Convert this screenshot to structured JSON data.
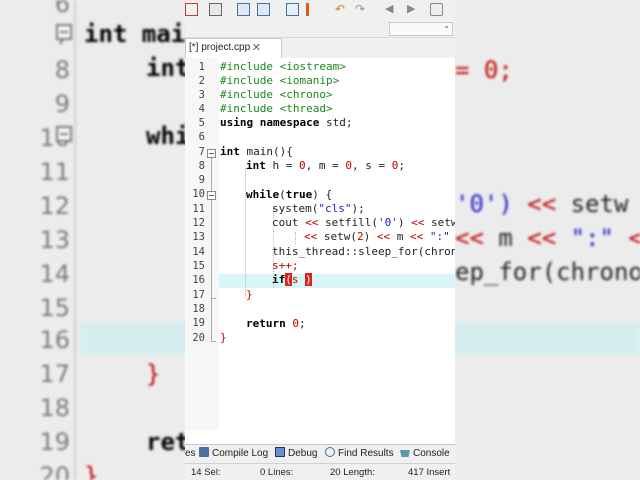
{
  "background_code": {
    "line_numbers": [
      "6",
      "7",
      "8",
      "9",
      "10",
      "11",
      "12",
      "13",
      "14",
      "15",
      "16",
      "17",
      "18",
      "19",
      "20"
    ],
    "line7": "int main",
    "line8": "int",
    "line8_tail": "= 0;",
    "line10": "whi",
    "line12_a": "'0')",
    "line12_b": "<<",
    "line12_c": "setw",
    "line13_a": "<<",
    "line13_b": "m",
    "line13_c": "<<",
    "line13_d": "\":\"",
    "line13_e": "<",
    "line14": "ep_for(chrono",
    "line17": "}",
    "line19": "ret",
    "line20": "}"
  },
  "toolbar": {
    "icons": [
      "bookmark-icon",
      "print-icon",
      "find-icon",
      "replace-icon",
      "goto-icon",
      "indent-icon",
      "undo-icon",
      "redo-icon",
      "back-icon",
      "forward-icon",
      "debug-icon"
    ]
  },
  "tab": {
    "label": "[*] project.cpp",
    "close": "✕"
  },
  "editor": {
    "line_numbers": [
      "1",
      "2",
      "3",
      "4",
      "5",
      "6",
      "7",
      "8",
      "9",
      "10",
      "11",
      "12",
      "13",
      "14",
      "15",
      "16",
      "17",
      "18",
      "19",
      "20"
    ],
    "lines": {
      "l1_a": "#include ",
      "l1_b": "<iostream>",
      "l2_a": "#include ",
      "l2_b": "<iomanip>",
      "l3_a": "#include ",
      "l3_b": "<chrono>",
      "l4_a": "#include ",
      "l4_b": "<thread>",
      "l5_a": "using namespace",
      "l5_b": " std;",
      "l7_a": "int",
      "l7_b": " main(){",
      "l8_a": "int",
      "l8_b": " h = ",
      "l8_c": "0",
      "l8_d": ", m = ",
      "l8_e": "0",
      "l8_f": ", s = ",
      "l8_g": "0",
      "l8_h": ";",
      "l10_a": "while",
      "l10_b": "(",
      "l10_c": "true",
      "l10_d": ") {",
      "l11_a": "system(",
      "l11_b": "\"cls\"",
      "l11_c": ");",
      "l12_a": "cout ",
      "l12_b": "<<",
      "l12_c": " setfill(",
      "l12_d": "'0'",
      "l12_e": ") ",
      "l12_f": "<<",
      "l12_g": " setw",
      "l13_a": "<<",
      "l13_b": " setw(",
      "l13_c": "2",
      "l13_d": ") ",
      "l13_e": "<<",
      "l13_f": " m ",
      "l13_g": "<<",
      "l13_h": " \":\"",
      "l14_a": "this_thread::sleep_for(chrono",
      "l15_a": "s",
      "l15_b": "++;",
      "l16_a": "if",
      "l16_b": "(",
      "l16_c": "s ",
      "l16_d": ")",
      "l17_a": "}",
      "l19_a": "return",
      "l19_b": " ",
      "l19_c": "0",
      "l19_d": ";",
      "l20_a": "}"
    }
  },
  "bottom_tabs": [
    {
      "label": "es"
    },
    {
      "label": "Compile Log",
      "icon": "compile-log-icon"
    },
    {
      "label": "Debug",
      "icon": "debug-icon"
    },
    {
      "label": "Find Results",
      "icon": "find-results-icon"
    },
    {
      "label": "Console",
      "icon": "console-icon"
    }
  ],
  "status": {
    "sel": "14 Sel:",
    "lines": "0 Lines:",
    "length": "20 Length:",
    "insert": "417 Insert"
  },
  "colors": {
    "current_line": "#d9f6f6",
    "keyword": "#000000",
    "string": "#1b1bcc",
    "operator": "#c00000",
    "preprocessor": "#1a8a1a",
    "brace_match": "#e02020"
  }
}
